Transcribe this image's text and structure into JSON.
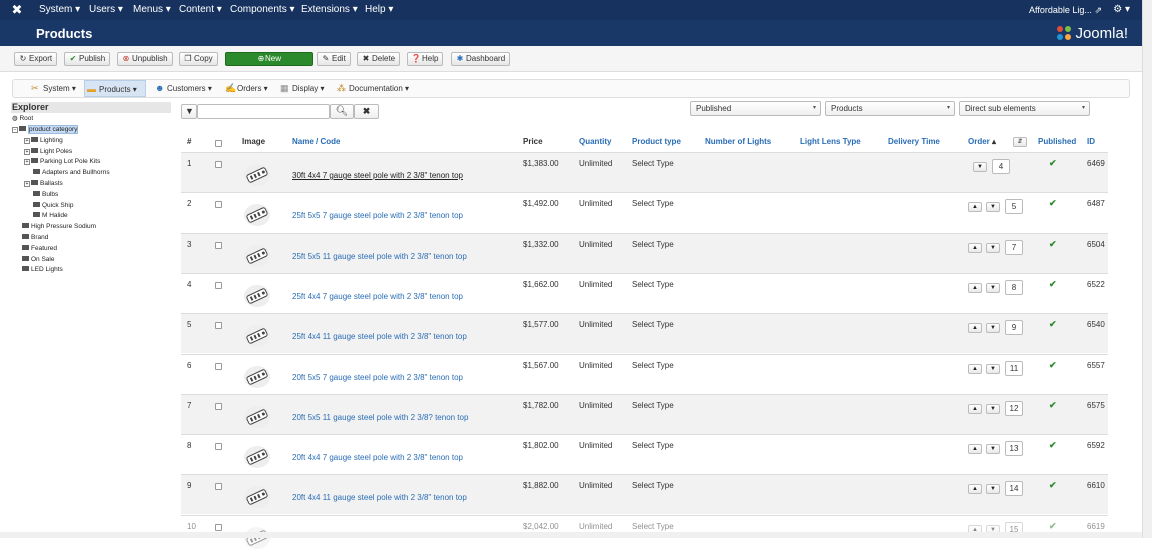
{
  "topbar": {
    "menus": [
      "System",
      "Users",
      "Menus",
      "Content",
      "Components",
      "Extensions",
      "Help"
    ],
    "site_name": "Affordable Lig..."
  },
  "header": {
    "title": "Products",
    "brand": "Joomla!"
  },
  "toolbar": {
    "export": "Export",
    "publish": "Publish",
    "unpublish": "Unpublish",
    "copy": "Copy",
    "new": "New",
    "edit": "Edit",
    "delete": "Delete",
    "help": "Help",
    "dashboard": "Dashboard"
  },
  "subnav": {
    "system": "System",
    "products": "Products",
    "customers": "Customers",
    "orders": "Orders",
    "display": "Display",
    "documentation": "Documentation"
  },
  "explorer": {
    "title": "Explorer",
    "root": "Root",
    "category": "product category",
    "children": [
      "Lighting",
      "Light Poles",
      "Parking Lot Pole Kits",
      "Adapters and Bullhorns",
      "Ballasts",
      "Bulbs",
      "Quick Ship",
      "M Halide"
    ],
    "top": [
      "High Pressure Sodium",
      "Brand",
      "Featured",
      "On Sale",
      "LED Lights"
    ]
  },
  "filters": {
    "search_value": "",
    "published": "Published",
    "products": "Products",
    "scope": "Direct sub elements"
  },
  "columns": {
    "num": "#",
    "image": "Image",
    "name": "Name / Code",
    "price": "Price",
    "quantity": "Quantity",
    "type": "Product type",
    "lights": "Number of Lights",
    "lens": "Light Lens Type",
    "delivery": "Delivery Time",
    "order": "Order",
    "published": "Published",
    "id": "ID"
  },
  "rows": [
    {
      "num": "1",
      "name": "30ft 4x4 7 gauge steel pole with 2 3/8\" tenon top",
      "price": "$1,383.00",
      "qty": "Unlimited",
      "type": "Select Type",
      "order": "4",
      "id": "6469"
    },
    {
      "num": "2",
      "name": "25ft 5x5 7 gauge steel pole with 2 3/8\" tenon top",
      "price": "$1,492.00",
      "qty": "Unlimited",
      "type": "Select Type",
      "order": "5",
      "id": "6487"
    },
    {
      "num": "3",
      "name": "25ft 5x5 11 gauge steel pole with 2 3/8\" tenon top",
      "price": "$1,332.00",
      "qty": "Unlimited",
      "type": "Select Type",
      "order": "7",
      "id": "6504"
    },
    {
      "num": "4",
      "name": "25ft 4x4 7 gauge steel pole with 2 3/8\" tenon top",
      "price": "$1,662.00",
      "qty": "Unlimited",
      "type": "Select Type",
      "order": "8",
      "id": "6522"
    },
    {
      "num": "5",
      "name": "25ft 4x4 11 gauge steel pole with 2 3/8\" tenon top",
      "price": "$1,577.00",
      "qty": "Unlimited",
      "type": "Select Type",
      "order": "9",
      "id": "6540"
    },
    {
      "num": "6",
      "name": "20ft 5x5 7 gauge steel pole with 2 3/8\" tenon top",
      "price": "$1,567.00",
      "qty": "Unlimited",
      "type": "Select Type",
      "order": "11",
      "id": "6557"
    },
    {
      "num": "7",
      "name": "20ft 5x5 11 gauge steel pole with 2 3/8? tenon top",
      "price": "$1,782.00",
      "qty": "Unlimited",
      "type": "Select Type",
      "order": "12",
      "id": "6575"
    },
    {
      "num": "8",
      "name": "20ft 4x4 7 gauge steel pole with 2 3/8\" tenon top",
      "price": "$1,802.00",
      "qty": "Unlimited",
      "type": "Select Type",
      "order": "13",
      "id": "6592"
    },
    {
      "num": "9",
      "name": "20ft 4x4 11 gauge steel pole with 2 3/8\" tenon top",
      "price": "$1,882.00",
      "qty": "Unlimited",
      "type": "Select Type",
      "order": "14",
      "id": "6610"
    },
    {
      "num": "10",
      "name": "",
      "price": "$2,042.00",
      "qty": "Unlimited",
      "type": "Select Type",
      "order": "15",
      "id": "6619"
    }
  ]
}
